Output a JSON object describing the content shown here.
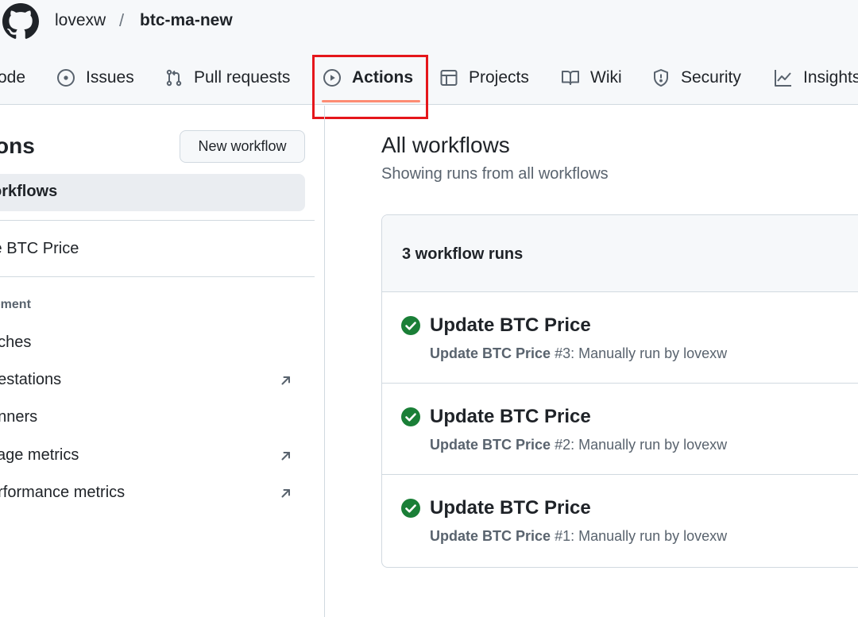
{
  "header": {
    "owner": "lovexw",
    "separator": "/",
    "repo": "btc-ma-new"
  },
  "tabs": [
    {
      "label": "ode",
      "icon": "code-icon"
    },
    {
      "label": "Issues",
      "icon": "issue-opened-icon"
    },
    {
      "label": "Pull requests",
      "icon": "git-pull-request-icon"
    },
    {
      "label": "Actions",
      "icon": "play-icon",
      "active": true
    },
    {
      "label": "Projects",
      "icon": "table-icon"
    },
    {
      "label": "Wiki",
      "icon": "book-icon"
    },
    {
      "label": "Security",
      "icon": "shield-icon"
    },
    {
      "label": "Insights",
      "icon": "graph-icon"
    }
  ],
  "sidebar": {
    "title": "ons",
    "new_workflow": "New workflow",
    "active_item": "orkflows",
    "workflows": [
      "te BTC Price"
    ],
    "management_heading": "gement",
    "management": [
      {
        "label": "aches",
        "external": false
      },
      {
        "label": "ttestations",
        "external": true
      },
      {
        "label": "unners",
        "external": false
      },
      {
        "label": "sage metrics",
        "external": true
      },
      {
        "label": "erformance metrics",
        "external": true
      }
    ]
  },
  "main": {
    "title": "All workflows",
    "subtitle": "Showing runs from all workflows",
    "runs_count": "3 workflow runs",
    "runs": [
      {
        "title": "Update BTC Price",
        "workflow": "Update BTC Price",
        "number": "#3",
        "detail": ": Manually run by lovexw",
        "status": "success"
      },
      {
        "title": "Update BTC Price",
        "workflow": "Update BTC Price",
        "number": "#2",
        "detail": ": Manually run by lovexw",
        "status": "success"
      },
      {
        "title": "Update BTC Price",
        "workflow": "Update BTC Price",
        "number": "#1",
        "detail": ": Manually run by lovexw",
        "status": "success"
      }
    ]
  },
  "colors": {
    "success": "#1a7f37",
    "active_tab_underline": "#fd8c73",
    "highlight_box": "#e5161b"
  }
}
